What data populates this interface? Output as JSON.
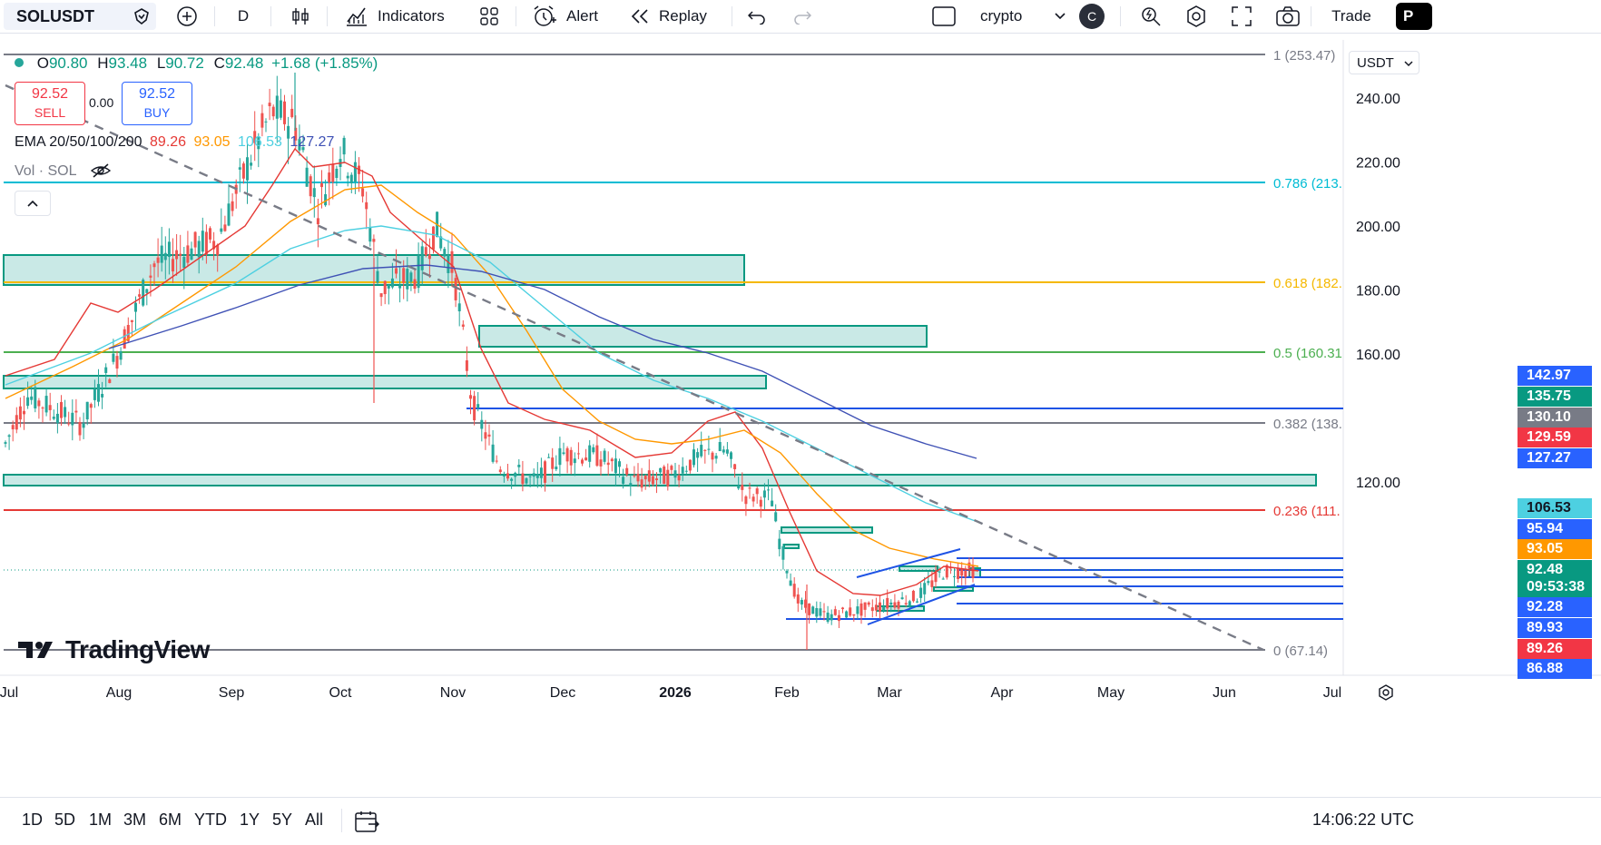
{
  "toolbar": {
    "symbol": "SOLUSDT",
    "interval": "D",
    "indicators_label": "Indicators",
    "alert_label": "Alert",
    "replay_label": "Replay",
    "layout_name": "crypto",
    "layout_badge": "C",
    "trade_label": "Trade",
    "publish_label": "P"
  },
  "legend": {
    "ohlc_o_label": "O",
    "ohlc_o": "90.80",
    "ohlc_h_label": "H",
    "ohlc_h": "93.48",
    "ohlc_l_label": "L",
    "ohlc_l": "90.72",
    "ohlc_c_label": "C",
    "ohlc_c": "92.48",
    "change": "+1.68 (+1.85%)",
    "sell_price": "92.52",
    "sell_label": "SELL",
    "spread": "0.00",
    "buy_price": "92.52",
    "buy_label": "BUY",
    "ema_label": "EMA 20/50/100/200",
    "ema20": "89.26",
    "ema50": "93.05",
    "ema100": "106.53",
    "ema200": "127.27",
    "vol_label": "Vol · SOL",
    "watermark": "TradingView"
  },
  "price_axis": {
    "currency": "USDT",
    "ticks": [
      "240.00",
      "220.00",
      "200.00",
      "180.00",
      "160.00",
      "120.00"
    ],
    "tags": [
      {
        "label": "142.97",
        "color": "#2962ff"
      },
      {
        "label": "135.75",
        "color": "#089981"
      },
      {
        "label": "130.10",
        "color": "#787b86"
      },
      {
        "label": "129.59",
        "color": "#f23645"
      },
      {
        "label": "127.27",
        "color": "#2962ff"
      },
      {
        "label": "106.53",
        "color": "#4dd0e1"
      },
      {
        "label": "95.94",
        "color": "#2962ff"
      },
      {
        "label": "93.05",
        "color": "#ff9800"
      },
      {
        "label": "92.48",
        "color": "#089981"
      },
      {
        "label": "09:53:38",
        "color": "#089981"
      },
      {
        "label": "92.28",
        "color": "#2962ff"
      },
      {
        "label": "89.93",
        "color": "#2962ff"
      },
      {
        "label": "89.26",
        "color": "#f23645"
      },
      {
        "label": "86.88",
        "color": "#2962ff"
      }
    ]
  },
  "fib_levels": [
    {
      "label": "1 (253.47)",
      "color": "#787b86"
    },
    {
      "label": "0.786 (213.",
      "color": "#00bcd4"
    },
    {
      "label": "0.618 (182.",
      "color": "#f5b800"
    },
    {
      "label": "0.5 (160.31",
      "color": "#4caf50"
    },
    {
      "label": "0.382 (138.",
      "color": "#787b86"
    },
    {
      "label": "0.236 (111.",
      "color": "#e53935"
    },
    {
      "label": "0 (67.14)",
      "color": "#787b86"
    }
  ],
  "time_axis": [
    "Jul",
    "Aug",
    "Sep",
    "Oct",
    "Nov",
    "Dec",
    "2026",
    "Feb",
    "Mar",
    "Apr",
    "May",
    "Jun",
    "Jul"
  ],
  "bottom": {
    "ranges": [
      "1D",
      "5D",
      "1M",
      "3M",
      "6M",
      "YTD",
      "1Y",
      "5Y",
      "All"
    ],
    "clock": "14:06:22 UTC"
  },
  "colors": {
    "up": "#26a69a",
    "down": "#ef5350",
    "ema20": "#e53935",
    "ema50": "#ff9800",
    "ema100": "#4dd0e1",
    "ema200": "#3f51b5",
    "zone_fill": "#b2dfdb",
    "zone_stroke": "#089981",
    "level_blue": "#1e53e5"
  }
}
